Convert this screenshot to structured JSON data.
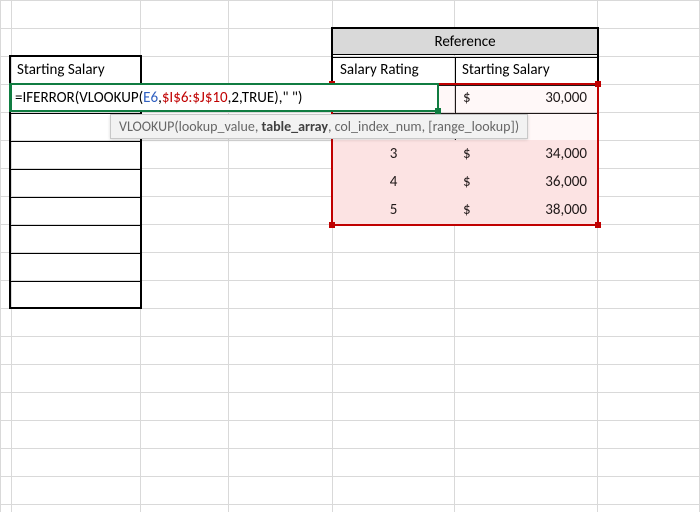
{
  "left_table": {
    "header": "Starting Salary"
  },
  "formula": {
    "eq": "=",
    "fn_outer": "IFERROR",
    "open1": "(",
    "fn_inner": "VLOOKUP",
    "open2": "(",
    "arg_lookup": "E6",
    "comma1": ",",
    "arg_range": "$I$6:$J$10",
    "comma2": ",",
    "arg_col": "2",
    "comma3": ",",
    "arg_match": "TRUE",
    "close2": ")",
    "comma4": ",",
    "arg_err": "\" \"",
    "close1": ")"
  },
  "hint": {
    "fn": "VLOOKUP",
    "p1": "lookup_value",
    "p2": "table_array",
    "p3": "col_index_num",
    "p4": "[range_lookup]"
  },
  "reference": {
    "title": "Reference",
    "col1": "Salary Rating",
    "col2": "Starting Salary",
    "currency": "$",
    "rows": [
      {
        "rating": "",
        "salary": "30,000"
      },
      {
        "rating": "",
        "salary": ""
      },
      {
        "rating": "3",
        "salary": "34,000"
      },
      {
        "rating": "4",
        "salary": "36,000"
      },
      {
        "rating": "5",
        "salary": "38,000"
      }
    ]
  }
}
